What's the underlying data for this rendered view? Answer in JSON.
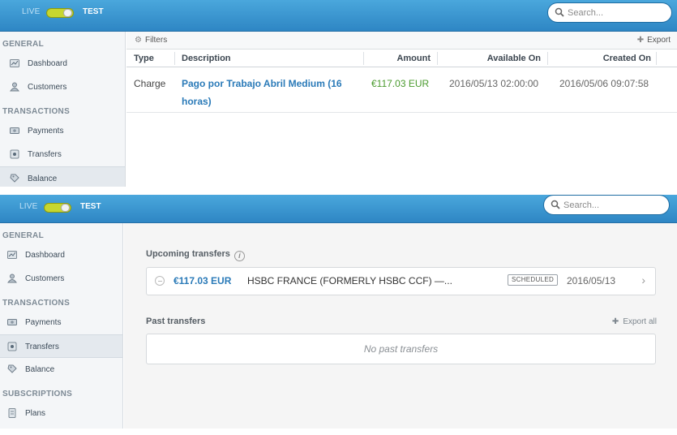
{
  "header": {
    "live_label": "LIVE",
    "test_label": "TEST",
    "search_placeholder": "Search..."
  },
  "sidebar": {
    "sections": [
      {
        "title": "GENERAL",
        "items": [
          "Dashboard",
          "Customers"
        ]
      },
      {
        "title": "TRANSACTIONS",
        "items": [
          "Payments",
          "Transfers",
          "Balance"
        ]
      },
      {
        "title": "SUBSCRIPTIONS",
        "items": [
          "Plans"
        ]
      }
    ],
    "icons": {
      "Dashboard": "dashboard-icon",
      "Customers": "customers-icon",
      "Payments": "payments-icon",
      "Transfers": "transfers-icon",
      "Balance": "balance-icon",
      "Plans": "plans-icon"
    }
  },
  "balance_view": {
    "active_item": "Balance",
    "filters_label": "Filters",
    "export_label": "Export",
    "columns": [
      "Type",
      "Description",
      "Amount",
      "Available On",
      "Created On"
    ],
    "rows": [
      {
        "type": "Charge",
        "description": "Pago por Trabajo Abril Medium (16 horas)",
        "amount": "€117.03 EUR",
        "available_on": "2016/05/13 02:00:00",
        "created_on": "2016/05/06 09:07:58"
      }
    ]
  },
  "transfers_view": {
    "active_item": "Transfers",
    "upcoming_title": "Upcoming transfers",
    "upcoming": [
      {
        "amount": "€117.03 EUR",
        "destination": "HSBC FRANCE (FORMERLY HSBC CCF) —...",
        "status": "SCHEDULED",
        "date": "2016/05/13"
      }
    ],
    "past_title": "Past transfers",
    "export_all_label": "Export all",
    "empty_text": "No past transfers"
  },
  "colors": {
    "header_top": "#4aa7dc",
    "header_bottom": "#2e86c4",
    "link_blue": "#2a7ab8",
    "amount_green": "#4a9a2e",
    "toggle_yellow": "#c6d62f"
  }
}
